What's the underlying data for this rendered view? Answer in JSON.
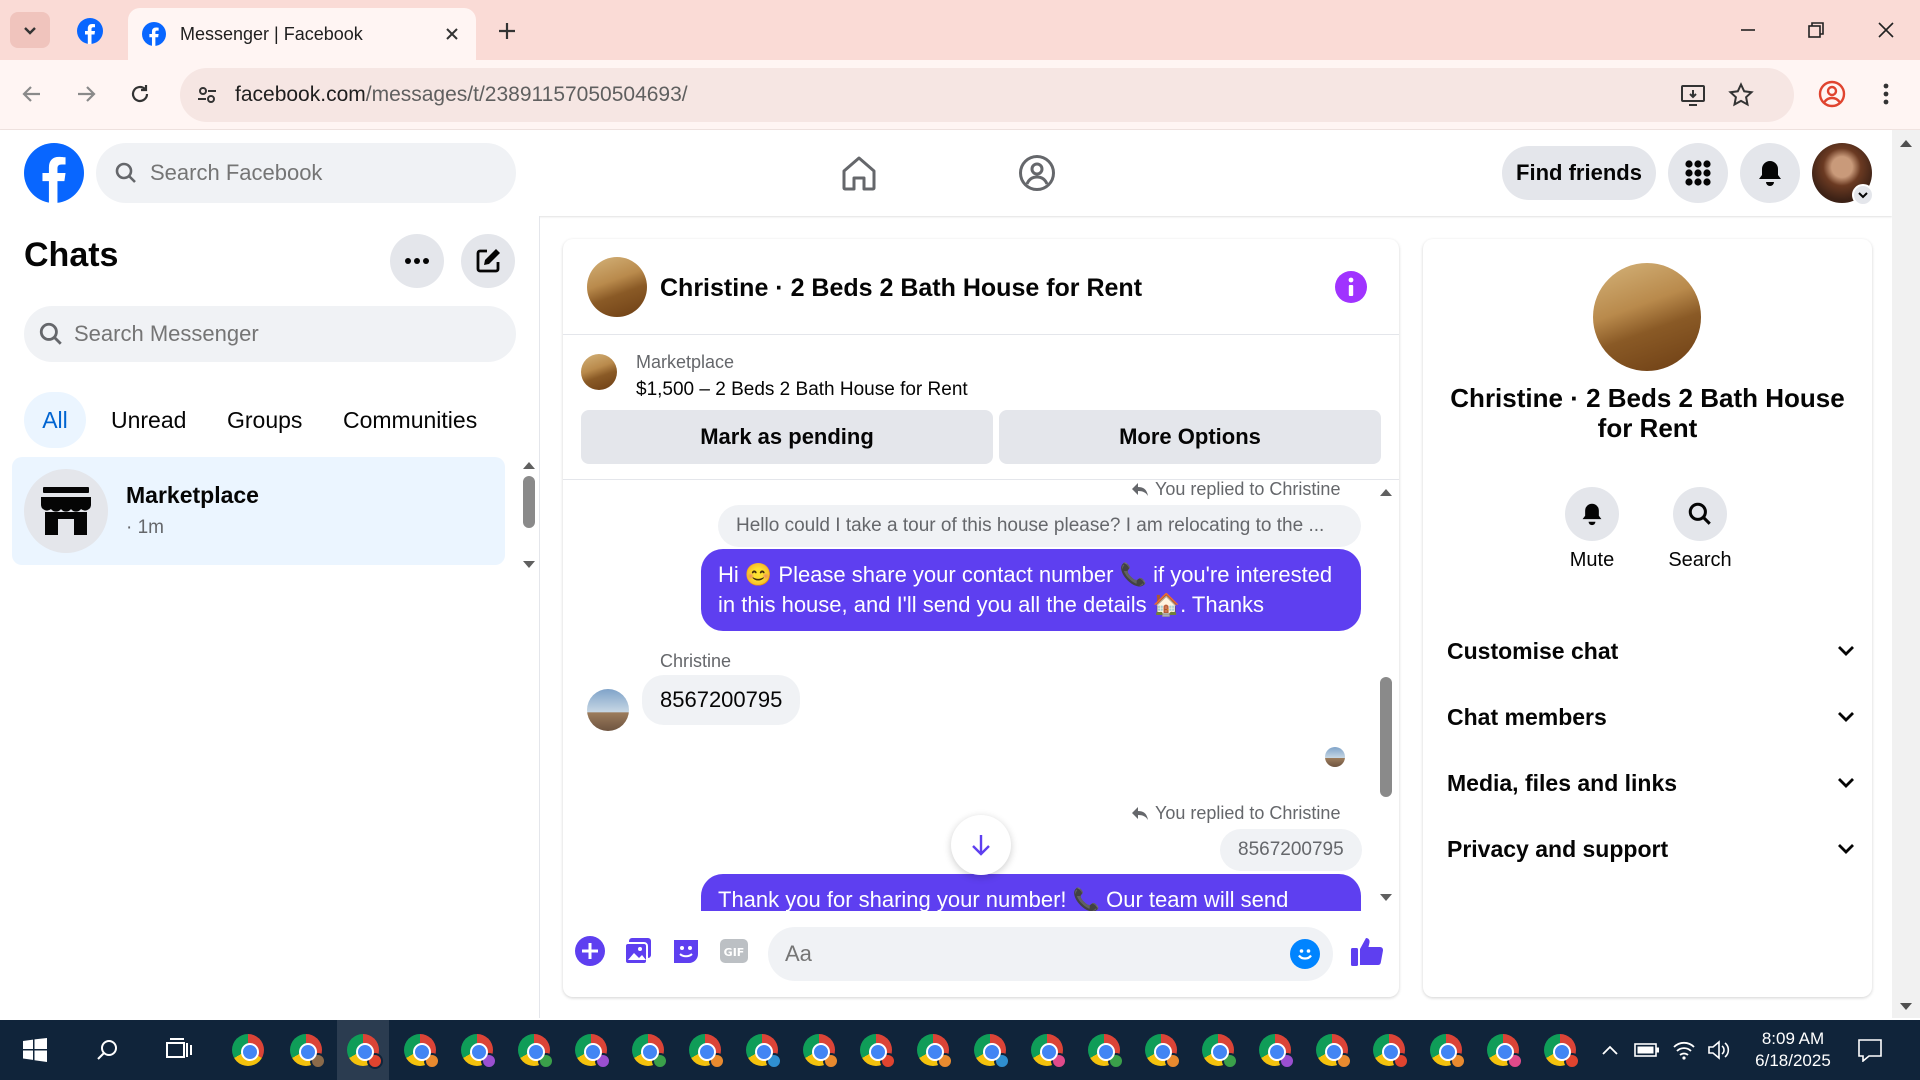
{
  "browser": {
    "tab_title": "Messenger | Facebook",
    "url_domain": "facebook.com",
    "url_path": "/messages/t/23891157050504693/"
  },
  "header": {
    "search_placeholder": "Search Facebook",
    "find_friends_label": "Find friends"
  },
  "sidebar": {
    "title": "Chats",
    "search_placeholder": "Search Messenger",
    "filters": [
      "All",
      "Unread",
      "Groups",
      "Communities"
    ],
    "active_filter": "All",
    "chats": [
      {
        "name": "Marketplace",
        "time": "· 1m"
      }
    ]
  },
  "conversation": {
    "title": "Christine · 2 Beds 2 Bath House for Rent",
    "marketplace_label": "Marketplace",
    "listing": "$1,500 – 2 Beds 2 Bath House for Rent",
    "mark_pending_label": "Mark as pending",
    "more_options_label": "More Options",
    "reply_note": "You replied to Christine",
    "quoted_1": "Hello could I take a tour of this house please?  I am relocating to the ...",
    "outgoing_1": "Hi 😊 Please share your contact number 📞 if you're interested in this house, and I'll send you all the details 🏠. Thanks",
    "sender_name": "Christine",
    "incoming_1": "8567200795",
    "reply_note_2": "You replied to Christine",
    "quoted_2": "8567200795",
    "outgoing_2": "Thank you for sharing your number! 📞 Our team will send",
    "composer_placeholder": "Aa"
  },
  "info_panel": {
    "title": "Christine · 2 Beds 2 Bath House for Rent",
    "actions": [
      "Mute",
      "Search"
    ],
    "sections": [
      "Customise chat",
      "Chat members",
      "Media, files and links",
      "Privacy and support"
    ]
  },
  "taskbar": {
    "time": "8:09 AM",
    "date": "6/18/2025"
  },
  "colors": {
    "fb_blue": "#0866ff",
    "outgoing_bubble": "#5e3ff0",
    "accent_purple": "#a033ff",
    "tab_strip": "#fadbd6",
    "taskbar": "#10243a"
  }
}
